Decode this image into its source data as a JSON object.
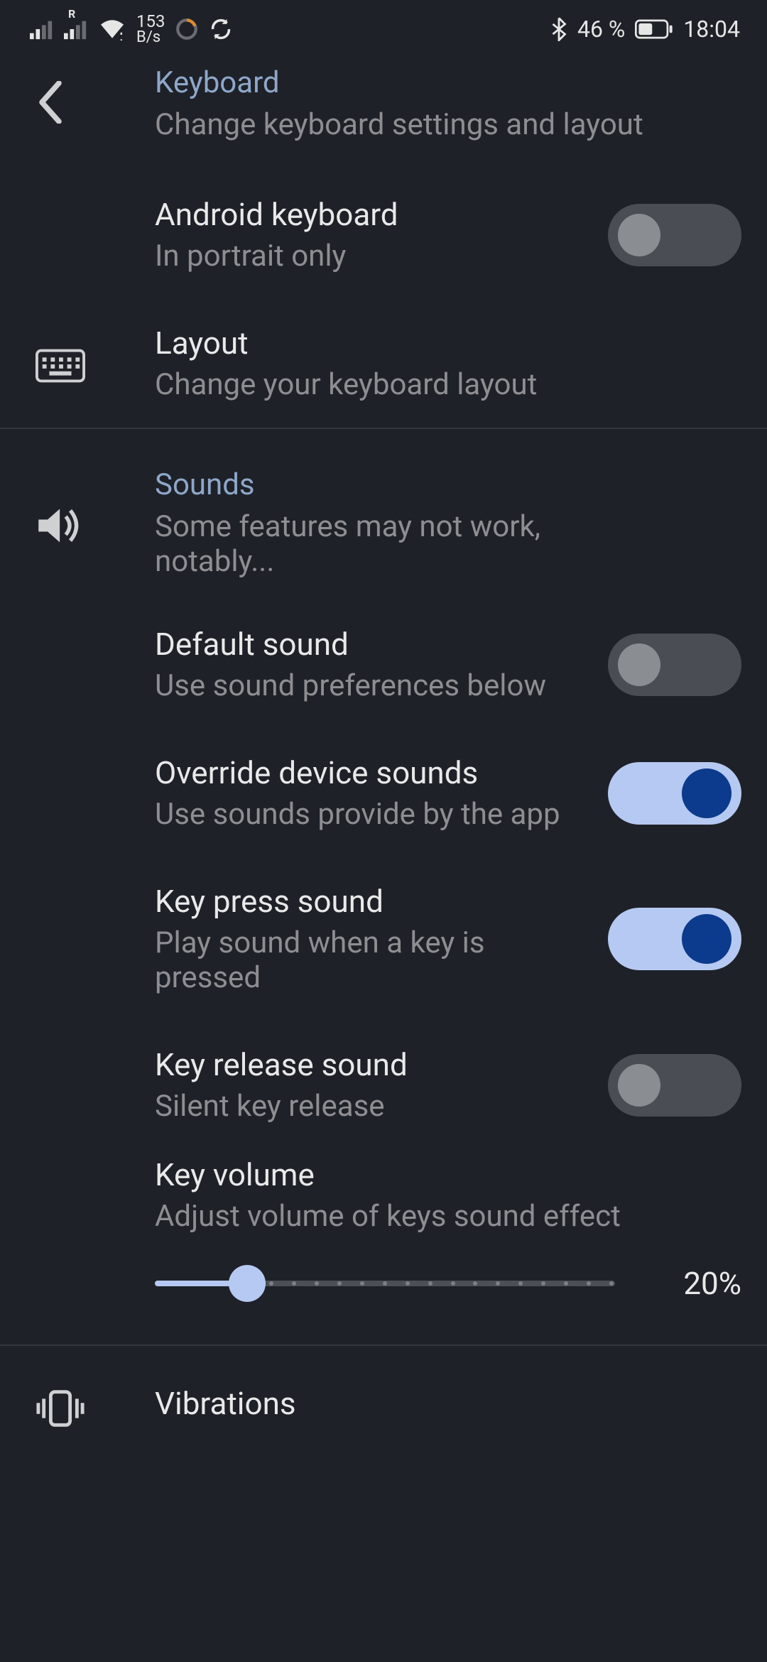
{
  "status": {
    "speed_num": "153",
    "speed_unit": "B/s",
    "bluetooth_battery": "46 %",
    "time": "18:04"
  },
  "header": {
    "category": "Keyboard",
    "subtitle": "Change keyboard settings and layout"
  },
  "rows": {
    "android_keyboard": {
      "title": "Android keyboard",
      "sub": "In portrait only",
      "on": false
    },
    "layout": {
      "title": "Layout",
      "sub": "Change your keyboard layout"
    }
  },
  "sounds_header": {
    "category": "Sounds",
    "subtitle": "Some features may not work, notably..."
  },
  "sound_rows": {
    "default_sound": {
      "title": "Default sound",
      "sub": "Use sound preferences below",
      "on": false
    },
    "override": {
      "title": "Override device sounds",
      "sub": "Use sounds provide by the app",
      "on": true
    },
    "key_press": {
      "title": "Key press sound",
      "sub": "Play sound when a key is pressed",
      "on": true
    },
    "key_release": {
      "title": "Key release sound",
      "sub": "Silent key release",
      "on": false
    }
  },
  "slider": {
    "title": "Key volume",
    "sub": "Adjust volume of keys sound effect",
    "percent": 20,
    "value_label": "20%"
  },
  "vibrations": {
    "title": "Vibrations"
  }
}
